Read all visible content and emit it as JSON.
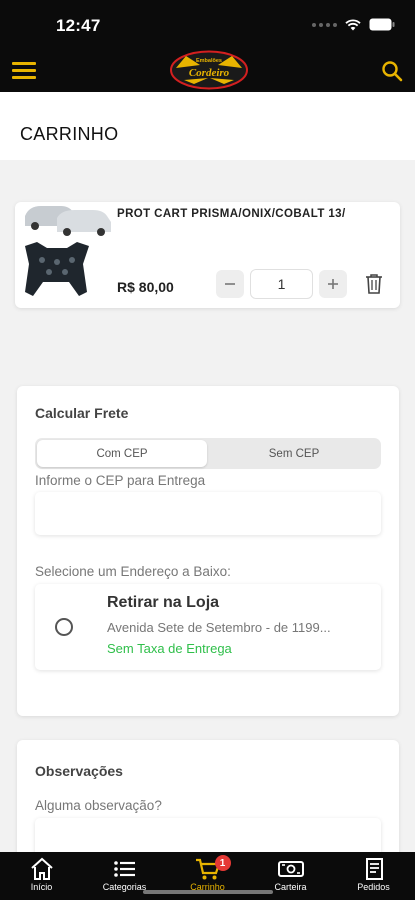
{
  "status": {
    "time": "12:47"
  },
  "brand": {
    "logo_top": "Embalões",
    "logo_main": "Cordeiro"
  },
  "colors": {
    "accent": "#e8b400",
    "dark": "#0b0b0b",
    "success": "#2fbf4a",
    "badge": "#e53935"
  },
  "header": {
    "title": "CARRINHO"
  },
  "cart": {
    "items": [
      {
        "name": "PROT CART PRISMA/ONIX/COBALT 13/",
        "price": "R$ 80,00",
        "quantity": "1"
      }
    ]
  },
  "frete": {
    "title": "Calcular Frete",
    "tabs": [
      "Com CEP",
      "Sem CEP"
    ],
    "active_tab": "Com CEP",
    "cep_label": "Informe o CEP para Entrega",
    "cep_value": "",
    "address_label": "Selecione um Endereço a Baixo:",
    "address": {
      "title": "Retirar na Loja",
      "line": "Avenida Sete de Setembro - de 1199...",
      "fee": "Sem Taxa de Entrega"
    }
  },
  "observacoes": {
    "title": "Observações",
    "label": "Alguma observação?"
  },
  "tabbar": {
    "items": [
      {
        "label": "Início",
        "icon": "home-icon"
      },
      {
        "label": "Categorias",
        "icon": "list-icon"
      },
      {
        "label": "Carrinho",
        "icon": "cart-icon",
        "badge": "1"
      },
      {
        "label": "Carteira",
        "icon": "wallet-icon"
      },
      {
        "label": "Pedidos",
        "icon": "receipt-icon"
      }
    ]
  }
}
